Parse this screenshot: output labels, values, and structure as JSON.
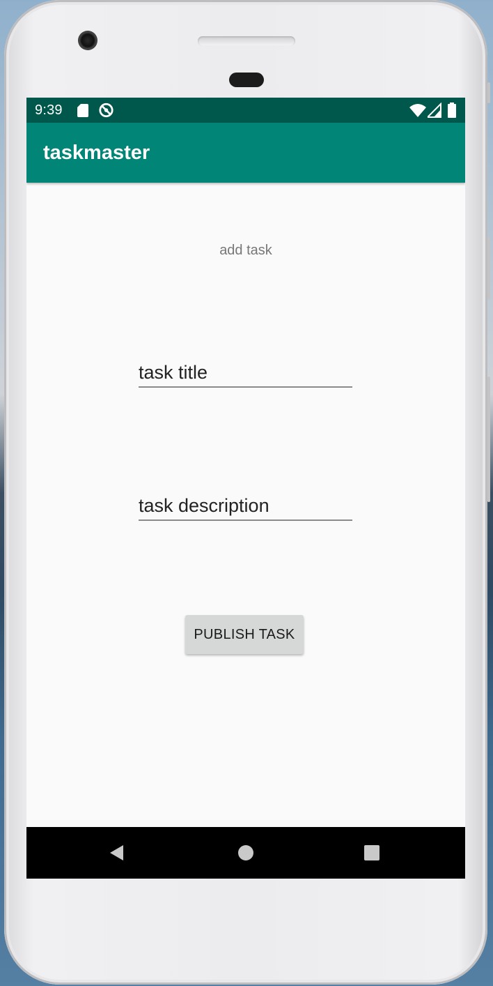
{
  "status_bar": {
    "time": "9:39",
    "left_icons": [
      "sd-card-icon",
      "do-not-disturb-icon"
    ],
    "right_icons": [
      "wifi-icon",
      "cell-signal-icon",
      "battery-icon"
    ]
  },
  "app_bar": {
    "title": "taskmaster"
  },
  "form": {
    "heading": "add task",
    "title_field": {
      "value": "task title"
    },
    "description_field": {
      "value": "task description"
    },
    "publish_button": "PUBLISH TASK"
  },
  "nav_bar": {
    "buttons": [
      "back-icon",
      "home-icon",
      "recents-icon"
    ]
  },
  "colors": {
    "status_bar": "#00574b",
    "app_bar": "#008577",
    "screen_background": "#fafafa",
    "button_background": "#d6d7d7"
  }
}
